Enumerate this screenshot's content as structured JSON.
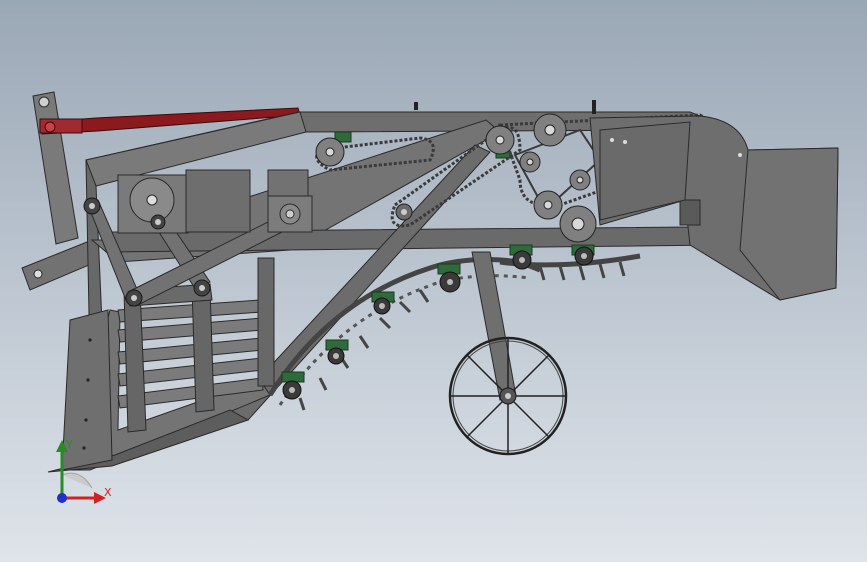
{
  "viewport": {
    "background_top": "#9aa7b5",
    "background_bottom": "#dfe4ea"
  },
  "model": {
    "body_color": "#6b6b6b",
    "edge_color": "#2a2a2a",
    "hitch_link_color": "#8b1a1f",
    "bearing_color": "#2f6b3a"
  },
  "triad": {
    "x_label": "X",
    "y_label": "Y",
    "x_color": "#d42020",
    "y_color": "#2a8a2a",
    "z_color": "#2030c8"
  }
}
